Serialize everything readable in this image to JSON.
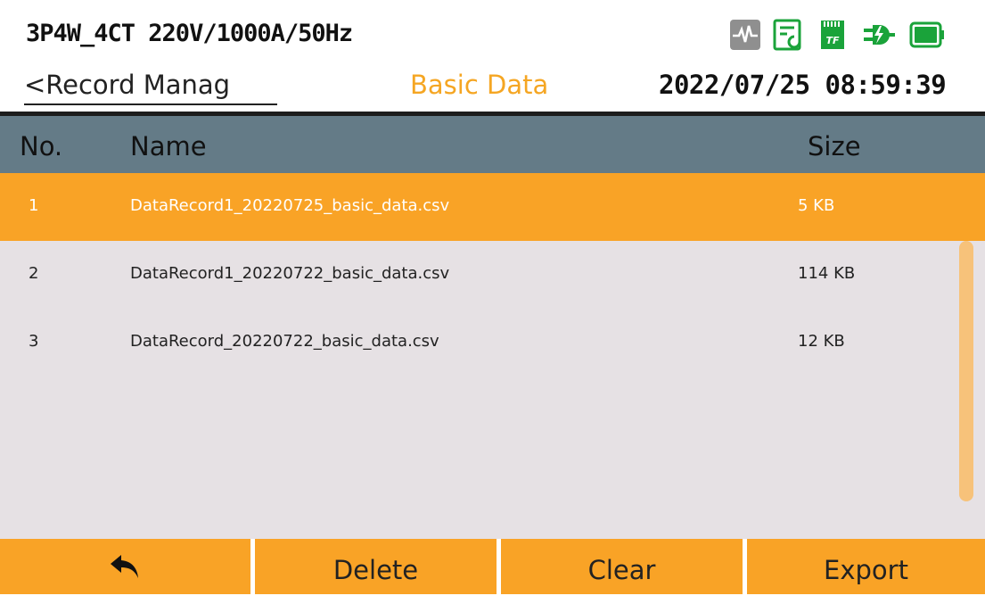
{
  "header": {
    "mode": "3P4W_4CT 220V/1000A/50Hz",
    "back_link": "<Record Manag",
    "page_title": "Basic Data",
    "datetime": "2022/07/25 08:59:39"
  },
  "status_icons": [
    "waveform-icon",
    "record-icon",
    "tf-card-icon",
    "plug-icon",
    "battery-icon"
  ],
  "colors": {
    "accent": "#f9a326",
    "title_accent": "#f5a623",
    "header_bg": "#647b87",
    "list_bg": "#e6e1e4",
    "icon_green": "#1aa33a"
  },
  "table": {
    "columns": {
      "no": "No.",
      "name": "Name",
      "size": "Size"
    },
    "rows": [
      {
        "no": "1",
        "name": "DataRecord1_20220725_basic_data.csv",
        "size": "5 KB",
        "selected": true
      },
      {
        "no": "2",
        "name": "DataRecord1_20220722_basic_data.csv",
        "size": "114 KB",
        "selected": false
      },
      {
        "no": "3",
        "name": "DataRecord_20220722_basic_data.csv",
        "size": "12 KB",
        "selected": false
      }
    ]
  },
  "buttons": {
    "back_icon": "back-arrow-icon",
    "delete": "Delete",
    "clear": "Clear",
    "export": "Export"
  }
}
